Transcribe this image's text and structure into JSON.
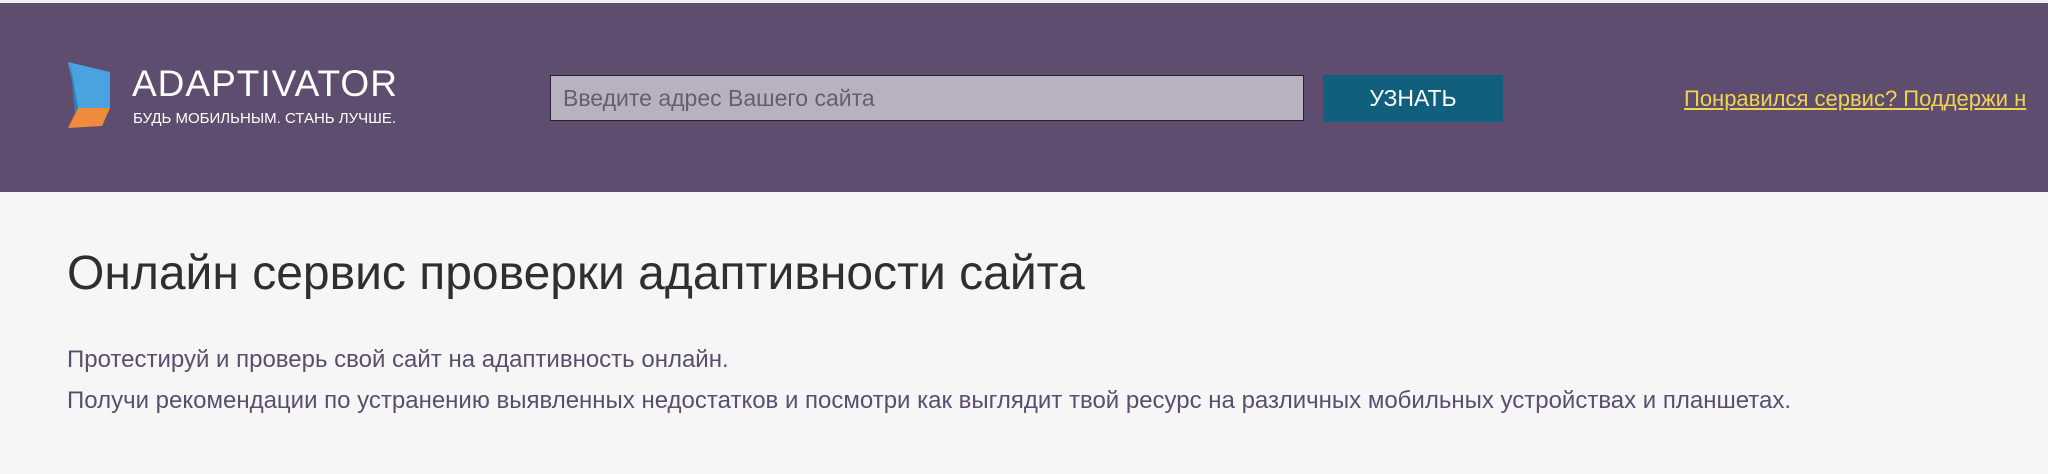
{
  "header": {
    "logo_title": "ADAPTIVATOR",
    "logo_tagline": "БУДЬ МОБИЛЬНЫМ. СТАНЬ ЛУЧШЕ.",
    "search": {
      "placeholder": "Введите адрес Вашего сайта",
      "value": ""
    },
    "check_button_label": "УЗНАТЬ",
    "support_link": "Понравился сервис? Поддержи н"
  },
  "main": {
    "title": "Онлайн сервис проверки адаптивности сайта",
    "description": [
      "Протестируй и проверь свой сайт на адаптивность онлайн.",
      "Получи рекомендации по устранению выявленных недостатков и посмотри как выглядит твой ресурс на различных мобильных устройствах и планшетах."
    ]
  },
  "colors": {
    "header_bg": "#5e4d6e",
    "input_bg": "#b8b1bf",
    "button_bg": "#0f5f7d",
    "link": "#f1d34d",
    "description_text": "#5b4d6e",
    "logo_blue": "#4aa3df",
    "logo_orange": "#f08a3c"
  },
  "icons": {
    "logo_mark": "adaptivator-logo-icon"
  }
}
